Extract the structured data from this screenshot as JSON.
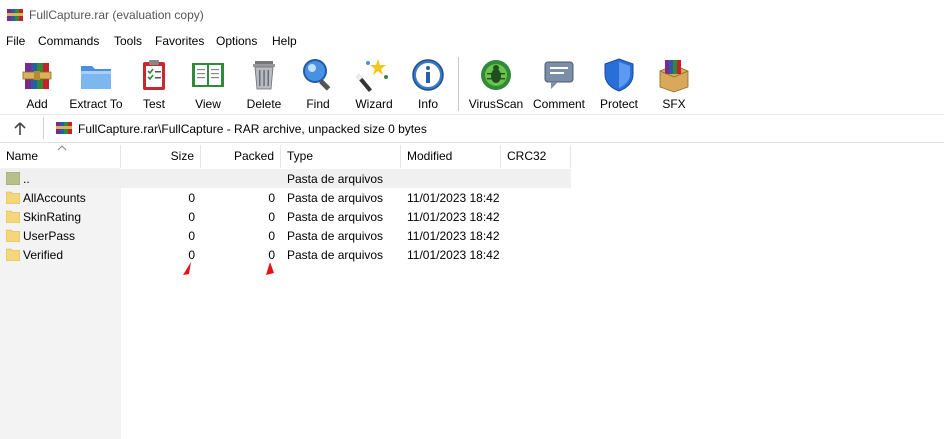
{
  "window": {
    "title": "FullCapture.rar (evaluation copy)"
  },
  "menu": [
    "File",
    "Commands",
    "Tools",
    "Favorites",
    "Options",
    "Help"
  ],
  "toolbar": {
    "add": "Add",
    "extract": "Extract To",
    "test": "Test",
    "view": "View",
    "delete": "Delete",
    "find": "Find",
    "wizard": "Wizard",
    "info": "Info",
    "virusscan": "VirusScan",
    "comment": "Comment",
    "protect": "Protect",
    "sfx": "SFX"
  },
  "address": {
    "path": "FullCapture.rar\\FullCapture - RAR archive, unpacked size 0 bytes"
  },
  "columns": {
    "name": "Name",
    "size": "Size",
    "packed": "Packed",
    "type": "Type",
    "modified": "Modified",
    "crc": "CRC32"
  },
  "rows": [
    {
      "name": "..",
      "size": "",
      "packed": "",
      "type": "Pasta de arquivos",
      "modified": ""
    },
    {
      "name": "AllAccounts",
      "size": "0",
      "packed": "0",
      "type": "Pasta de arquivos",
      "modified": "11/01/2023 18:42"
    },
    {
      "name": "SkinRating",
      "size": "0",
      "packed": "0",
      "type": "Pasta de arquivos",
      "modified": "11/01/2023 18:42"
    },
    {
      "name": "UserPass",
      "size": "0",
      "packed": "0",
      "type": "Pasta de arquivos",
      "modified": "11/01/2023 18:42"
    },
    {
      "name": "Verified",
      "size": "0",
      "packed": "0",
      "type": "Pasta de arquivos",
      "modified": "11/01/2023 18:42"
    }
  ],
  "colors": {
    "folder": "#f5d77a",
    "annotation": "#e8101a",
    "selected_row": "#f0f0f0"
  }
}
